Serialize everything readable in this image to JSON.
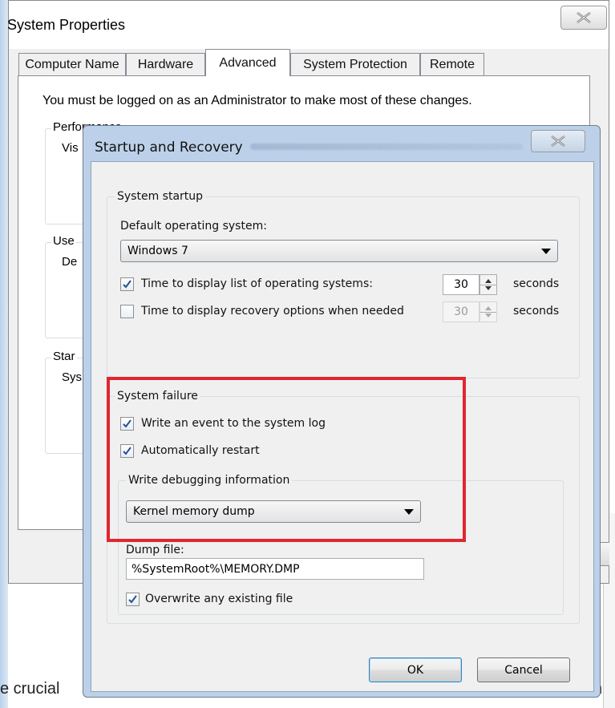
{
  "page": {
    "left_text": "e crucial",
    "right_text": "n"
  },
  "system_properties": {
    "title": "System Properties",
    "tabs": [
      {
        "label": "Computer Name",
        "active": false
      },
      {
        "label": "Hardware",
        "active": false
      },
      {
        "label": "Advanced",
        "active": true
      },
      {
        "label": "System Protection",
        "active": false
      },
      {
        "label": "Remote",
        "active": false
      }
    ],
    "admin_note": "You must be logged on as an Administrator to make most of these changes.",
    "groups": {
      "performance_label": "Performance",
      "performance_text": "Vis",
      "user_profiles_label": "Use",
      "user_profiles_text": "De",
      "startup_label": "Star",
      "startup_text": "Sys"
    }
  },
  "startup_recovery": {
    "title": "Startup and Recovery",
    "system_startup": {
      "group_label": "System startup",
      "default_os_label": "Default operating system:",
      "default_os_value": "Windows 7",
      "display_list": {
        "checked": true,
        "label": "Time to display list of operating systems:",
        "value": "30",
        "unit": "seconds"
      },
      "display_recovery": {
        "checked": false,
        "label": "Time to display recovery options when needed",
        "value": "30",
        "unit": "seconds"
      }
    },
    "system_failure": {
      "group_label": "System failure",
      "write_event": {
        "checked": true,
        "label": "Write an event to the system log"
      },
      "auto_restart": {
        "checked": true,
        "label": "Automatically restart"
      },
      "debug_group_label": "Write debugging information",
      "debug_type": "Kernel memory dump",
      "dump_file_label": "Dump file:",
      "dump_file_value": "%SystemRoot%\\MEMORY.DMP",
      "overwrite": {
        "checked": true,
        "label": "Overwrite any existing file"
      }
    },
    "buttons": {
      "ok": "OK",
      "cancel": "Cancel"
    }
  },
  "colors": {
    "highlight": "#e0262f",
    "dialog_frame": "#bcd1e9",
    "window_face": "#f0f0f0"
  },
  "icons": {
    "close": "close-x-icon",
    "check": "checkmark-icon",
    "dropdown": "chevron-down-icon"
  }
}
